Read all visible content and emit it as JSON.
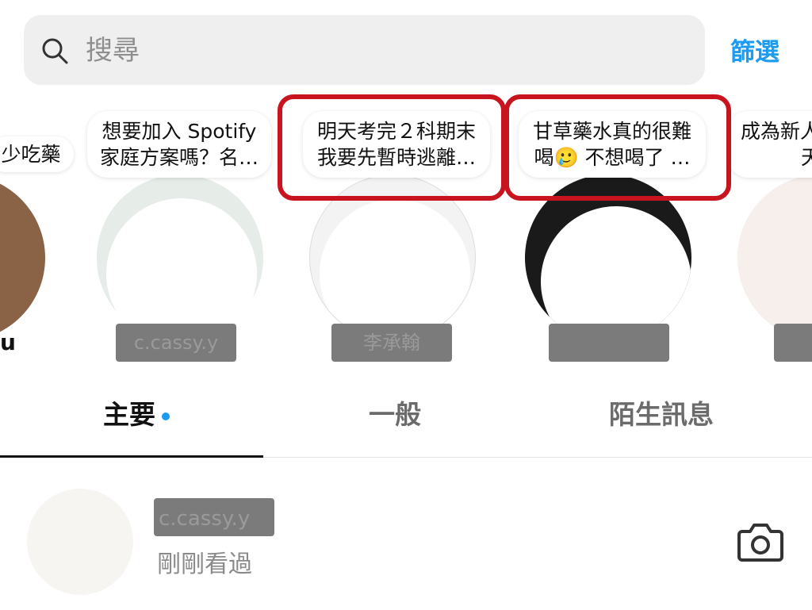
{
  "search": {
    "placeholder": "搜尋"
  },
  "filter_label": "篩選",
  "stories": [
    {
      "note_lines": [
        "少吃藥"
      ],
      "username_partial": "u"
    },
    {
      "note_lines": [
        "想要加入 Spotify",
        "家庭方案嗎？名…"
      ],
      "username": "c.cassy.y"
    },
    {
      "note_lines": [
        "明天考完２科期末",
        "我要先暫時逃離…"
      ],
      "username": "李承翰",
      "highlighted": true
    },
    {
      "note_lines": [
        "甘草藥水真的很難",
        "喝🥲 不想喝了 …"
      ],
      "username": "",
      "highlighted": true
    },
    {
      "note_lines": [
        "成為新人",
        "天"
      ],
      "username": ""
    }
  ],
  "tabs": [
    {
      "label": "主要",
      "active": true,
      "has_dot": true
    },
    {
      "label": "一般",
      "active": false
    },
    {
      "label": "陌生訊息",
      "active": false
    }
  ],
  "message": {
    "name": "c.cassy.y",
    "subtitle": "剛剛看過"
  },
  "colors": {
    "accent": "#1d9bf0",
    "highlight_box": "#c8141e",
    "search_bg": "#efefef"
  },
  "icons": [
    "search-icon",
    "camera-icon"
  ]
}
